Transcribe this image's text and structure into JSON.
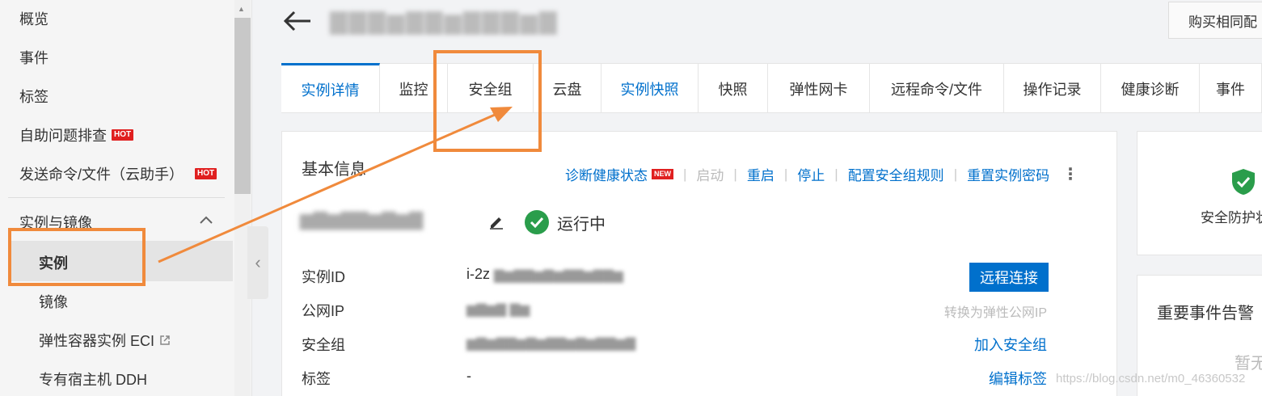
{
  "sidebar": {
    "items": [
      {
        "label": "概览"
      },
      {
        "label": "事件"
      },
      {
        "label": "标签"
      },
      {
        "label": "自助问题排查",
        "badge": "HOT"
      },
      {
        "label": "发送命令/文件（云助手）",
        "badge": "HOT"
      }
    ],
    "group": {
      "label": "实例与镜像"
    },
    "sub_items": [
      {
        "label": "实例"
      },
      {
        "label": "镜像"
      },
      {
        "label": "弹性容器实例 ECI"
      },
      {
        "label": "专有宿主机 DDH"
      }
    ]
  },
  "header": {
    "buy_label": "购买相同配"
  },
  "tabs": [
    {
      "label": "实例详情"
    },
    {
      "label": "监控"
    },
    {
      "label": "安全组"
    },
    {
      "label": "云盘"
    },
    {
      "label": "实例快照"
    },
    {
      "label": "快照"
    },
    {
      "label": "弹性网卡"
    },
    {
      "label": "远程命令/文件"
    },
    {
      "label": "操作记录"
    },
    {
      "label": "健康诊断"
    },
    {
      "label": "事件"
    }
  ],
  "basic_info": {
    "title": "基本信息",
    "actions": {
      "diagnose": "诊断健康状态",
      "diagnose_badge": "NEW",
      "start": "启动",
      "restart": "重启",
      "stop": "停止",
      "config_rules": "配置安全组规则",
      "reset_password": "重置实例密码"
    },
    "status": "运行中",
    "rows": [
      {
        "label": "实例ID",
        "value": "i-2z",
        "action": "远程连接"
      },
      {
        "label": "公网IP",
        "action": "转换为弹性公网IP"
      },
      {
        "label": "安全组",
        "action": "加入安全组"
      },
      {
        "label": "标签",
        "value": "-",
        "action": "编辑标签"
      }
    ]
  },
  "right_panel": {
    "protection_label": "安全防护状",
    "alert_title": "重要事件告警",
    "alert_empty": "暂无"
  },
  "watermark": "https://blog.csdn.net/m0_46360532",
  "colors": {
    "accent": "#0070cc",
    "hot_badge": "#e02020",
    "annotation": "#f08a3c",
    "running": "#2a9d4b"
  }
}
